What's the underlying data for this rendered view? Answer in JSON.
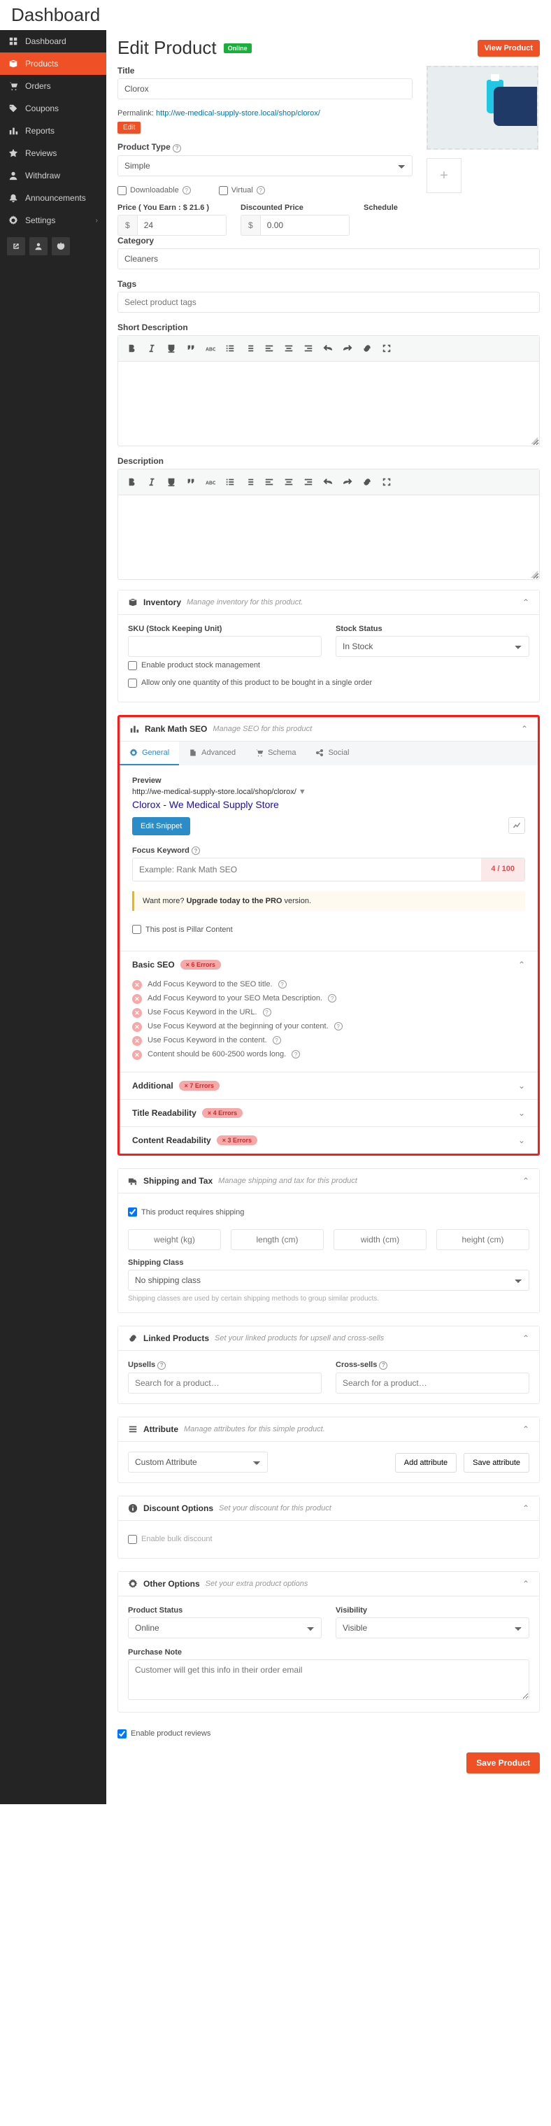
{
  "page_title": "Dashboard",
  "sidebar": {
    "items": [
      {
        "label": "Dashboard",
        "icon": "dashboard"
      },
      {
        "label": "Products",
        "icon": "box",
        "active": true
      },
      {
        "label": "Orders",
        "icon": "cart"
      },
      {
        "label": "Coupons",
        "icon": "tag"
      },
      {
        "label": "Reports",
        "icon": "chart"
      },
      {
        "label": "Reviews",
        "icon": "star"
      },
      {
        "label": "Withdraw",
        "icon": "user"
      },
      {
        "label": "Announcements",
        "icon": "bell"
      },
      {
        "label": "Settings",
        "icon": "gear",
        "chev": true
      }
    ]
  },
  "header": {
    "title": "Edit Product",
    "status": "Online",
    "view_btn": "View Product"
  },
  "title_section": {
    "label": "Title",
    "value": "Clorox"
  },
  "permalink": {
    "label": "Permalink:",
    "url": "http://we-medical-supply-store.local/shop/clorox/",
    "edit_btn": "Edit"
  },
  "product_type": {
    "label": "Product Type",
    "value": "Simple"
  },
  "flags": {
    "downloadable": "Downloadable",
    "virtual": "Virtual"
  },
  "price": {
    "label": "Price ( You Earn : $ 21.6 )",
    "currency": "$",
    "value": "24"
  },
  "discounted": {
    "label": "Discounted Price",
    "currency": "$",
    "value": "0.00"
  },
  "schedule": {
    "label": "Schedule"
  },
  "category": {
    "label": "Category",
    "value": "Cleaners"
  },
  "tags": {
    "label": "Tags",
    "placeholder": "Select product tags"
  },
  "short_desc_label": "Short Description",
  "desc_label": "Description",
  "inventory": {
    "title": "Inventory",
    "sub": "Manage inventory for this product.",
    "sku_label": "SKU (Stock Keeping Unit)",
    "stock_label": "Stock Status",
    "stock_value": "In Stock",
    "enable_stock": "Enable product stock management",
    "one_qty": "Allow only one quantity of this product to be bought in a single order"
  },
  "rankmath": {
    "title": "Rank Math SEO",
    "sub": "Manage SEO for this product",
    "tabs": {
      "general": "General",
      "advanced": "Advanced",
      "schema": "Schema",
      "social": "Social"
    },
    "preview_label": "Preview",
    "preview_url": "http://we-medical-supply-store.local/shop/clorox/",
    "preview_title": "Clorox - We Medical Supply Store",
    "edit_snippet": "Edit Snippet",
    "fk_label": "Focus Keyword",
    "fk_placeholder": "Example: Rank Math SEO",
    "fk_score": "4 / 100",
    "upgrade_pre": "Want more? ",
    "upgrade_bold": "Upgrade today to the PRO",
    "upgrade_post": " version.",
    "pillar": "This post is Pillar Content",
    "basic": {
      "title": "Basic SEO",
      "badge": "× 6 Errors",
      "items": [
        "Add Focus Keyword to the SEO title.",
        "Add Focus Keyword to your SEO Meta Description.",
        "Use Focus Keyword in the URL.",
        "Use Focus Keyword at the beginning of your content.",
        "Use Focus Keyword in the content.",
        "Content should be 600-2500 words long."
      ]
    },
    "additional": {
      "title": "Additional",
      "badge": "× 7 Errors"
    },
    "title_read": {
      "title": "Title Readability",
      "badge": "× 4 Errors"
    },
    "content_read": {
      "title": "Content Readability",
      "badge": "× 3 Errors"
    }
  },
  "shipping": {
    "title": "Shipping and Tax",
    "sub": "Manage shipping and tax for this product",
    "requires": "This product requires shipping",
    "weight": "weight (kg)",
    "length": "length (cm)",
    "width": "width (cm)",
    "height": "height (cm)",
    "class_label": "Shipping Class",
    "class_value": "No shipping class",
    "hint": "Shipping classes are used by certain shipping methods to group similar products."
  },
  "linked": {
    "title": "Linked Products",
    "sub": "Set your linked products for upsell and cross-sells",
    "upsells": "Upsells",
    "cross": "Cross-sells",
    "placeholder": "Search for a product…"
  },
  "attribute": {
    "title": "Attribute",
    "sub": "Manage attributes for this simple product.",
    "custom": "Custom Attribute",
    "add": "Add attribute",
    "save": "Save attribute"
  },
  "discount": {
    "title": "Discount Options",
    "sub": "Set your discount for this product",
    "enable": "Enable bulk discount"
  },
  "other": {
    "title": "Other Options",
    "sub": "Set your extra product options",
    "status_label": "Product Status",
    "status_value": "Online",
    "vis_label": "Visibility",
    "vis_value": "Visible",
    "note_label": "Purchase Note",
    "note_placeholder": "Customer will get this info in their order email"
  },
  "reviews_ck": "Enable product reviews",
  "save_btn": "Save Product"
}
